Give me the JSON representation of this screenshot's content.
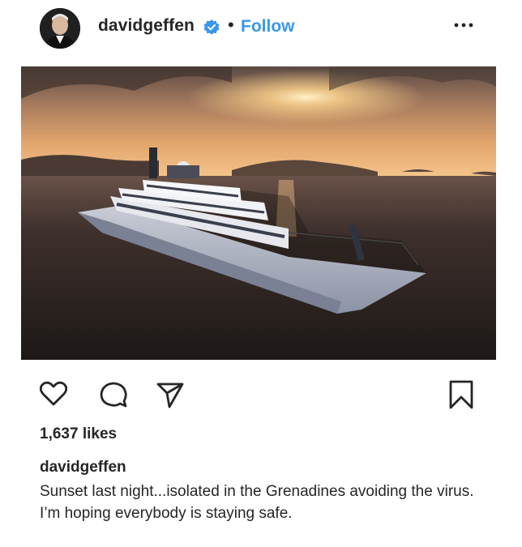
{
  "header": {
    "username": "davidgeffen",
    "separator": "•",
    "follow_label": "Follow",
    "verified_icon": "verified-badge-icon",
    "more_icon": "more-options-icon"
  },
  "post": {
    "image_icon": "yacht-sunset-photo",
    "actions": {
      "like_icon": "heart-icon",
      "comment_icon": "comment-icon",
      "share_icon": "share-icon",
      "save_icon": "bookmark-icon"
    },
    "likes": "1,637 likes",
    "caption": {
      "username": "davidgeffen",
      "text": "Sunset last night...isolated in the Grenadines avoiding the virus. I’m hoping everybody is staying safe."
    }
  },
  "colors": {
    "accent": "#3897f0",
    "text": "#262626"
  }
}
